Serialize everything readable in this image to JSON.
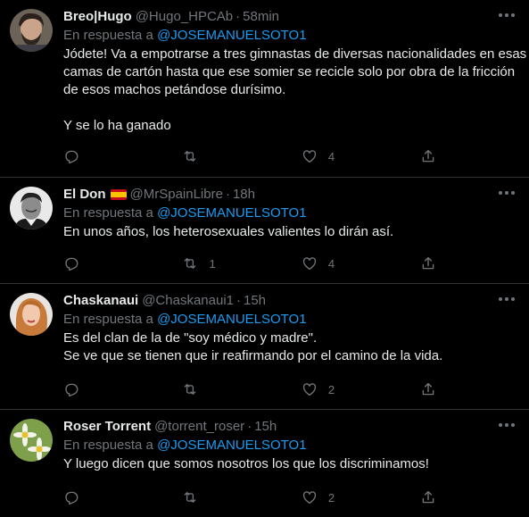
{
  "reply_prefix": "En respuesta a",
  "tweets": [
    {
      "display_name": "Breo|Hugo",
      "handle": "@Hugo_HPCAb",
      "separator": "·",
      "time": "58min",
      "reply_to": "@JOSEMANUELSOTO1",
      "text_lines": [
        "Jódete! Va a empotrarse a tres gimnastas de diversas nacionalidades en esas",
        "camas de cartón hasta que ese somier se recicle solo por obra de la fricción",
        "de esos machos petándose durísimo.",
        "",
        "Y se lo ha ganado"
      ],
      "replies": "",
      "retweets": "",
      "likes": "4"
    },
    {
      "display_name": "El Don",
      "flag": "spain-flag",
      "handle": "@MrSpainLibre",
      "separator": "·",
      "time": "18h",
      "reply_to": "@JOSEMANUELSOTO1",
      "text_lines": [
        "En unos años, los heterosexuales valientes lo dirán así."
      ],
      "replies": "",
      "retweets": "1",
      "likes": "4"
    },
    {
      "display_name": "Chaskanaui",
      "handle": "@Chaskanaui1",
      "separator": "·",
      "time": "15h",
      "reply_to": "@JOSEMANUELSOTO1",
      "text_lines": [
        "Es del clan de la de \"soy médico y madre\".",
        "Se ve que se tienen que ir reafirmando por el camino de la vida."
      ],
      "replies": "",
      "retweets": "",
      "likes": "2"
    },
    {
      "display_name": "Roser Torrent",
      "handle": "@torrent_roser",
      "separator": "·",
      "time": "15h",
      "reply_to": "@JOSEMANUELSOTO1",
      "text_lines": [
        "Y luego dicen que somos nosotros los que los discriminamos!"
      ],
      "replies": "",
      "retweets": "",
      "likes": "2"
    }
  ],
  "colors": {
    "background": "#000000",
    "text": "#e7e9ea",
    "muted": "#71767b",
    "link": "#1d9bf0",
    "divider": "#2f3336"
  },
  "icons": [
    "reply-icon",
    "retweet-icon",
    "like-icon",
    "share-icon",
    "more-icon"
  ]
}
